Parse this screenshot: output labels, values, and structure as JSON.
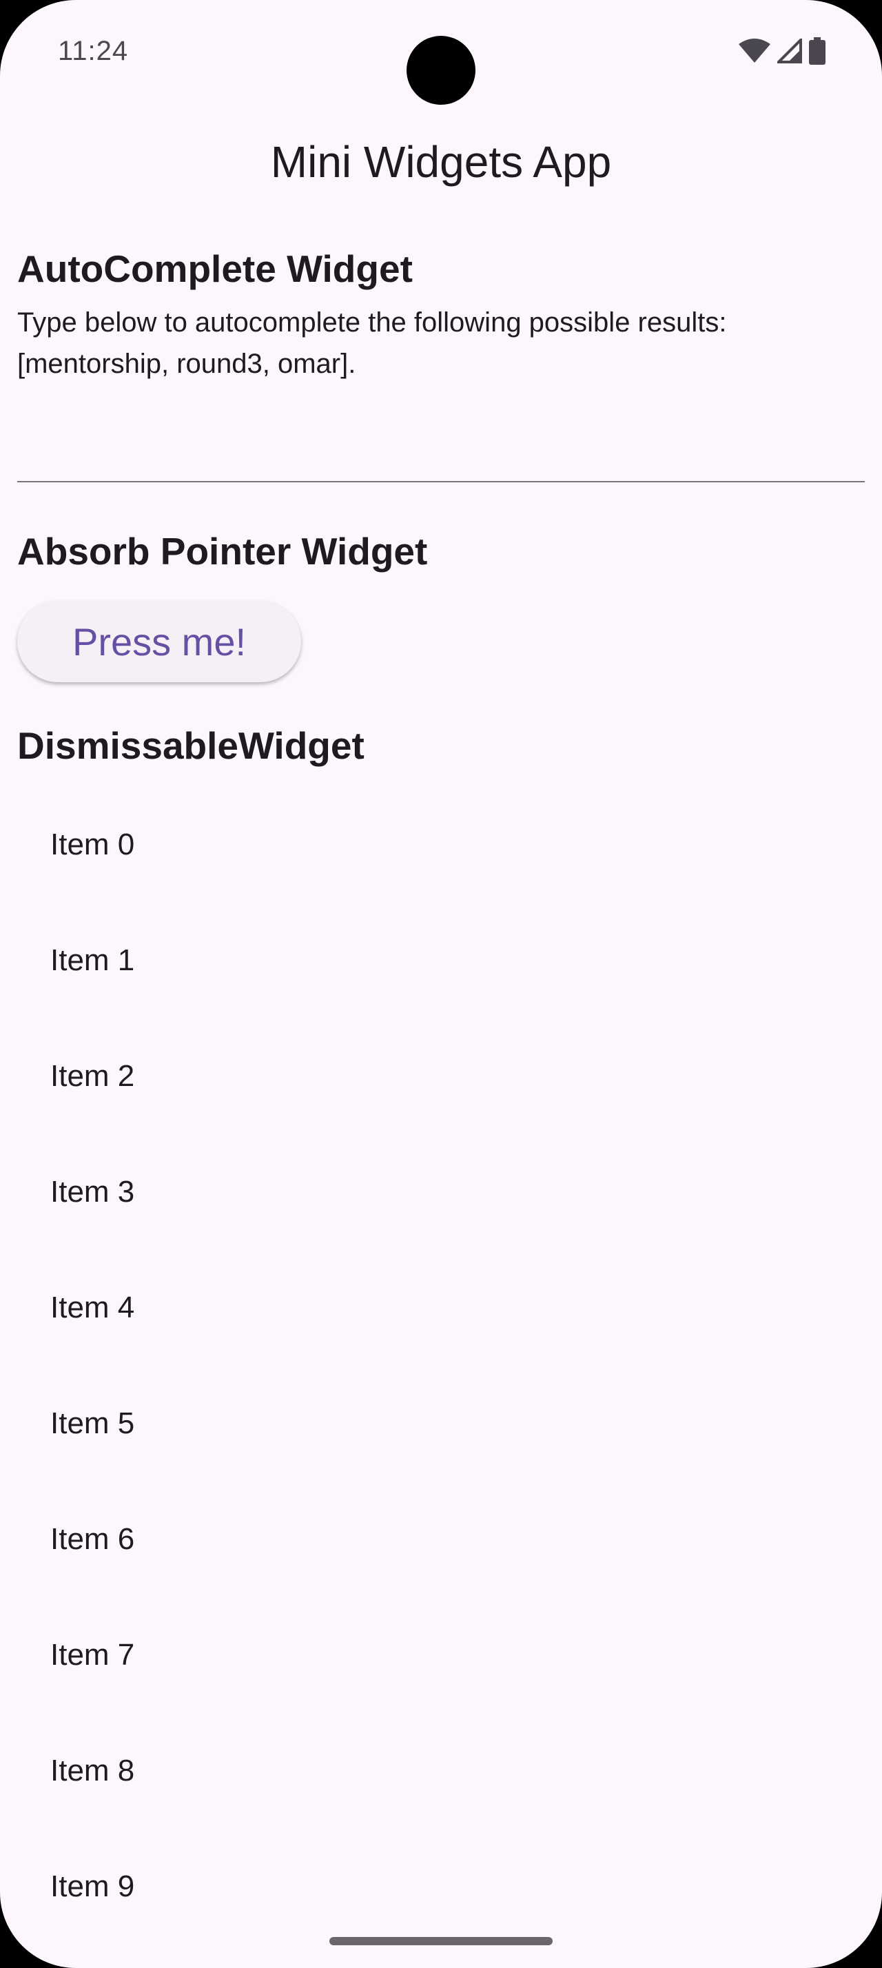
{
  "status_bar": {
    "time": "11:24",
    "icons": [
      "wifi-icon",
      "cellular-signal-icon",
      "battery-icon"
    ]
  },
  "app_bar": {
    "title": "Mini Widgets App"
  },
  "autocomplete_section": {
    "title": "AutoComplete Widget",
    "description": "Type below to autocomplete the following possible results: [mentorship, round3, omar].",
    "input_value": ""
  },
  "absorb_section": {
    "title": "Absorb Pointer Widget",
    "button_label": "Press me!"
  },
  "dismissable_section": {
    "title": "DismissableWidget",
    "items": [
      "Item 0",
      "Item 1",
      "Item 2",
      "Item 3",
      "Item 4",
      "Item 5",
      "Item 6",
      "Item 7",
      "Item 8",
      "Item 9"
    ]
  },
  "colors": {
    "background": "#FDF7FD",
    "accent": "#6750A4",
    "text": "#1D1B20",
    "button_bg": "#F4F0F5"
  }
}
